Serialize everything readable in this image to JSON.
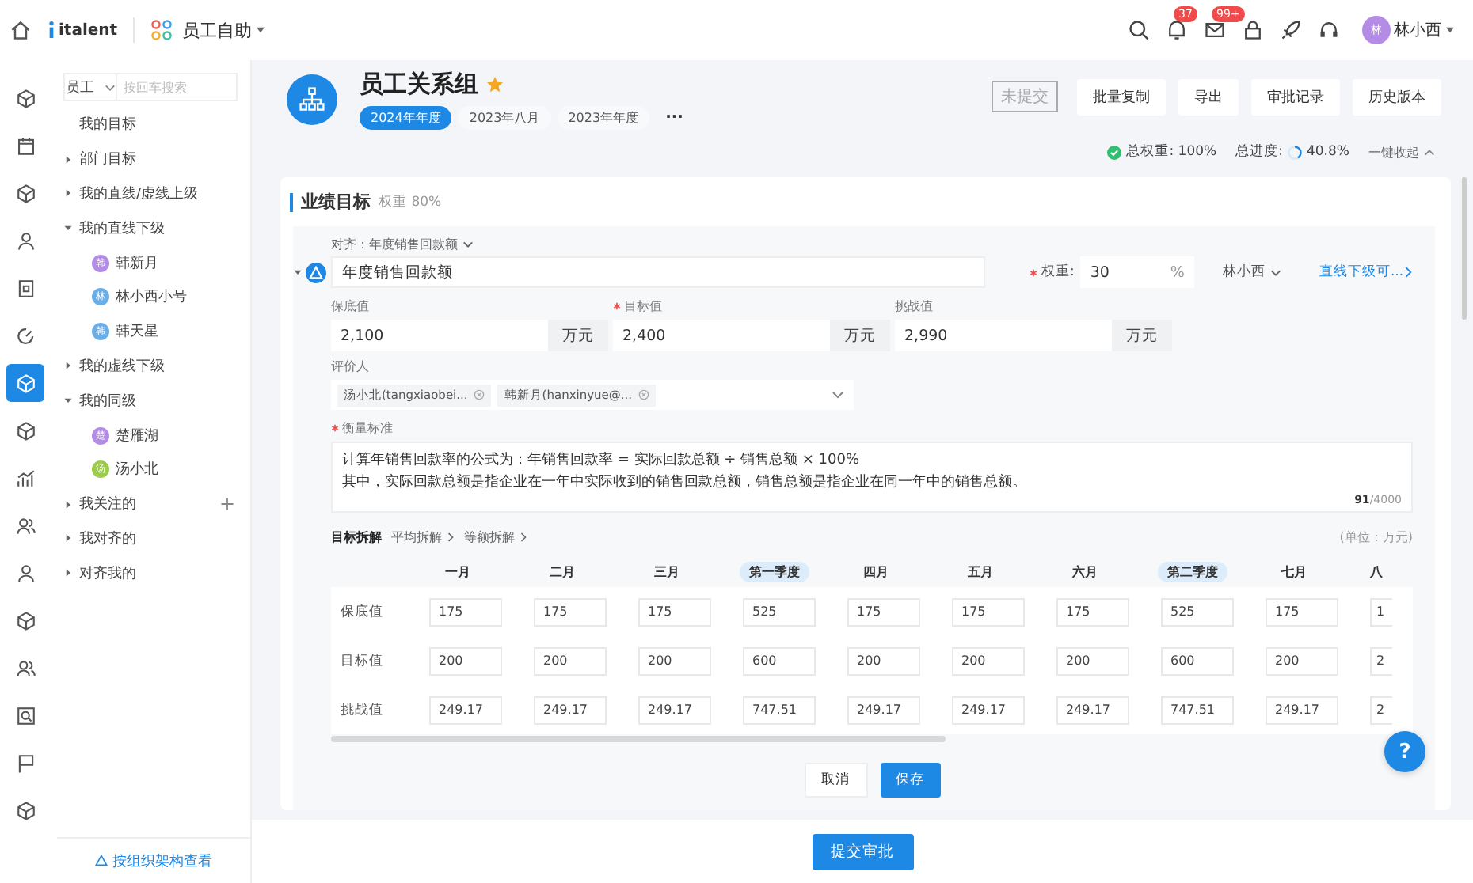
{
  "topbar": {
    "logo": "italent",
    "app": "员工自助",
    "badges": [
      {
        "kind": "bell",
        "count": "37"
      },
      {
        "kind": "mail",
        "count": "99+"
      }
    ],
    "user": {
      "avatar": "林",
      "name": "林小西"
    }
  },
  "rail": [
    {
      "kind": "cube",
      "selected": false
    },
    {
      "kind": "calendar",
      "selected": false
    },
    {
      "kind": "cube",
      "selected": false
    },
    {
      "kind": "person",
      "selected": false
    },
    {
      "kind": "doc",
      "selected": false
    },
    {
      "kind": "gauge",
      "selected": false
    },
    {
      "kind": "cube",
      "selected": true
    },
    {
      "kind": "cube",
      "selected": false
    },
    {
      "kind": "chart",
      "selected": false
    },
    {
      "kind": "people",
      "selected": false
    },
    {
      "kind": "person",
      "selected": false
    },
    {
      "kind": "cube",
      "selected": false
    },
    {
      "kind": "people",
      "selected": false
    },
    {
      "kind": "search",
      "selected": false
    },
    {
      "kind": "flag",
      "selected": false
    },
    {
      "kind": "cube",
      "selected": false
    }
  ],
  "sidebar": {
    "filter": "员工",
    "search": {
      "placeholder": "按回车搜索"
    },
    "items": [
      {
        "label": "我的目标",
        "kind": "leaf"
      },
      {
        "label": "部门目标",
        "kind": "group",
        "expanded": false
      },
      {
        "label": "我的直线/虚线上级",
        "kind": "group",
        "expanded": false
      },
      {
        "label": "我的直线下级",
        "kind": "group",
        "expanded": true,
        "children": [
          {
            "label": "韩新月",
            "avatar": "韩",
            "color": "#b48ce6"
          },
          {
            "label": "林小西小号",
            "avatar": "林",
            "color": "#6aaee8"
          },
          {
            "label": "韩天星",
            "avatar": "韩",
            "color": "#6aaee8"
          }
        ]
      },
      {
        "label": "我的虚线下级",
        "kind": "group",
        "expanded": false
      },
      {
        "label": "我的同级",
        "kind": "group",
        "expanded": true,
        "children": [
          {
            "label": "楚雁湖",
            "avatar": "楚",
            "color": "#b48ce6"
          },
          {
            "label": "汤小北",
            "avatar": "汤",
            "color": "#9ccc4a"
          }
        ]
      },
      {
        "label": "我关注的",
        "kind": "group",
        "expanded": false,
        "addable": true
      },
      {
        "label": "我对齐的",
        "kind": "group",
        "expanded": false
      },
      {
        "label": "对齐我的",
        "kind": "group",
        "expanded": false
      }
    ],
    "footer_link": "按组织架构查看"
  },
  "header": {
    "title": "员工关系组",
    "starred": true,
    "periods": [
      {
        "label": "2024年年度",
        "selected": true
      },
      {
        "label": "2023年八月",
        "selected": false
      },
      {
        "label": "2023年年度",
        "selected": false
      }
    ],
    "more": "···",
    "status": "未提交",
    "buttons": [
      "批量复制",
      "导出",
      "审批记录",
      "历史版本"
    ]
  },
  "summary": {
    "weight_label": "总权重:",
    "weight": "100%",
    "progress_label": "总进度:",
    "progress": "40.8%",
    "level": 0.408,
    "collapse": "一键收起"
  },
  "section": {
    "title": "业绩目标",
    "weight": "权重 80%"
  },
  "goal": {
    "align": "对齐：年度销售回款额",
    "name": "年度销售回款额",
    "weight_required": true,
    "weight_label": "权重:",
    "weight": "30",
    "weight_unit": "%",
    "owner": "林小西",
    "link": "直线下级可...",
    "values": [
      {
        "label": "保底值",
        "required": false,
        "value": "2,100",
        "unit": "万元"
      },
      {
        "label": "目标值",
        "required": true,
        "value": "2,400",
        "unit": "万元"
      },
      {
        "label": "挑战值",
        "required": false,
        "value": "2,990",
        "unit": "万元"
      }
    ],
    "reviewer_label": "评价人",
    "reviewers": [
      "汤小北(tangxiaobei...",
      "韩新月(hanxinyue@..."
    ],
    "measure_required": true,
    "measure_label": "衡量标准",
    "measure_lines": [
      "计算年销售回款率的公式为：年销售回款率 = 实际回款总额 ÷ 销售总额 × 100%",
      "其中，实际回款总额是指企业在一年中实际收到的销售回款总额，销售总额是指企业在同一年中的销售总额。"
    ],
    "measure_count": "91",
    "measure_max": "/4000",
    "breakdown": {
      "tabs": [
        {
          "label": "目标拆解",
          "selected": true
        },
        {
          "label": "平均拆解",
          "selected": false
        },
        {
          "label": "等额拆解",
          "selected": false
        }
      ],
      "unit": "(单位：万元)",
      "columns": [
        {
          "label": "一月",
          "quarter": false
        },
        {
          "label": "二月",
          "quarter": false
        },
        {
          "label": "三月",
          "quarter": false
        },
        {
          "label": "第一季度",
          "quarter": true
        },
        {
          "label": "四月",
          "quarter": false
        },
        {
          "label": "五月",
          "quarter": false
        },
        {
          "label": "六月",
          "quarter": false
        },
        {
          "label": "第二季度",
          "quarter": true
        },
        {
          "label": "七月",
          "quarter": false
        },
        {
          "label": "八",
          "quarter": false
        }
      ],
      "rows": [
        {
          "label": "保底值",
          "values": [
            "175",
            "175",
            "175",
            "525",
            "175",
            "175",
            "175",
            "525",
            "175",
            "1"
          ]
        },
        {
          "label": "目标值",
          "values": [
            "200",
            "200",
            "200",
            "600",
            "200",
            "200",
            "200",
            "600",
            "200",
            "2"
          ]
        },
        {
          "label": "挑战值",
          "values": [
            "249.17",
            "249.17",
            "249.17",
            "747.51",
            "249.17",
            "249.17",
            "249.17",
            "747.51",
            "249.17",
            "2"
          ]
        }
      ]
    },
    "cancel": "取消",
    "save": "保存"
  },
  "submit": "提交审批",
  "help": "?"
}
